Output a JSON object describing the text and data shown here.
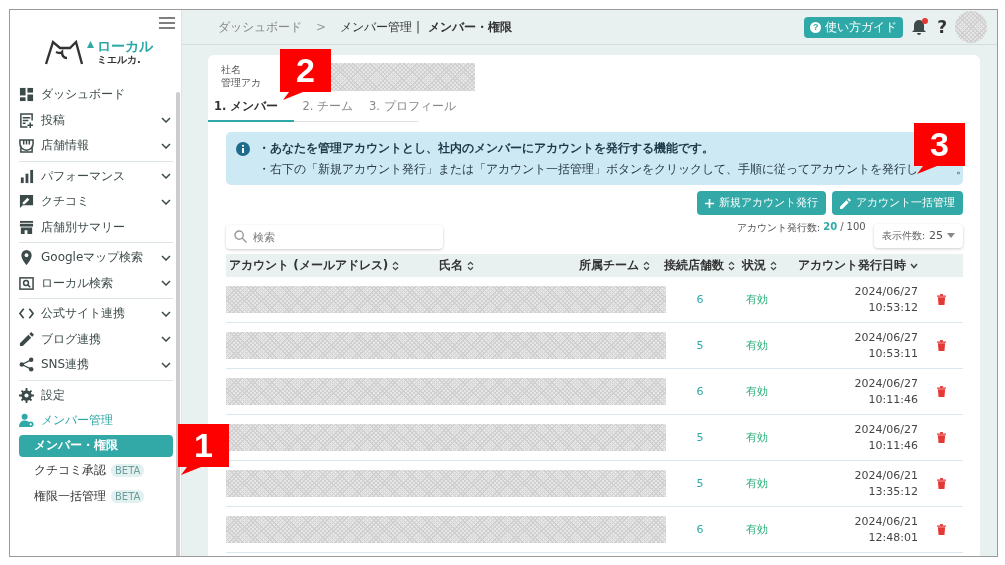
{
  "sidebar": {
    "logo": {
      "main": "ローカル",
      "sub": "ミエルカ."
    },
    "groups": [
      {
        "items": [
          {
            "label": "ダッシュボード",
            "kind": "dashboard",
            "expandable": false
          },
          {
            "label": "投稿",
            "kind": "post",
            "expandable": true
          },
          {
            "label": "店舗情報",
            "kind": "store",
            "expandable": true
          }
        ]
      },
      {
        "items": [
          {
            "label": "パフォーマンス",
            "kind": "bars",
            "expandable": true
          },
          {
            "label": "クチコミ",
            "kind": "review",
            "expandable": true
          },
          {
            "label": "店舗別サマリー",
            "kind": "shop",
            "expandable": false
          }
        ]
      },
      {
        "items": [
          {
            "label": "Googleマップ検索",
            "kind": "pin",
            "expandable": true
          },
          {
            "label": "ローカル検索",
            "kind": "search",
            "expandable": true
          }
        ]
      },
      {
        "items": [
          {
            "label": "公式サイト連携",
            "kind": "code",
            "expandable": true
          },
          {
            "label": "ブログ連携",
            "kind": "pencil",
            "expandable": true
          },
          {
            "label": "SNS連携",
            "kind": "share",
            "expandable": true
          }
        ]
      },
      {
        "items": [
          {
            "label": "設定",
            "kind": "gear",
            "expandable": false
          },
          {
            "label": "メンバー管理",
            "kind": "members",
            "expandable": false,
            "expanded": true,
            "children": [
              {
                "label": "メンバー・権限",
                "selected": true
              },
              {
                "label": "クチコミ承認",
                "selected": false,
                "badge": "BETA"
              },
              {
                "label": "権限一括管理",
                "selected": false,
                "badge": "BETA"
              }
            ]
          }
        ]
      }
    ]
  },
  "header": {
    "breadcrumb": "ダッシュボード",
    "separator": ">",
    "section": "メンバー管理",
    "divider": "|",
    "title": "メンバー・権限",
    "guide_icon": "?",
    "guide_button": "使い方ガイド",
    "notification": true,
    "help": "?"
  },
  "card": {
    "company_label": "社名",
    "admin_label": "管理アカ",
    "tabs": [
      {
        "label": "1. メンバー",
        "selected": true
      },
      {
        "label": "2. チーム",
        "selected": false
      },
      {
        "label": "3. プロフィール",
        "selected": false
      }
    ],
    "info": {
      "line_1": "・あなたを管理アカウントとし、社内のメンバーにアカウントを発行する機能です。",
      "line_2": "・右下の「新規アカウント発行」または「アカウント一括管理」ボタンをクリックして、手順に従ってアカウントを発行し",
      "line_2_tail": "。"
    },
    "buttons": [
      {
        "label": "新規アカウント発行",
        "kind": "plus"
      },
      {
        "label": "アカウント一括管理",
        "kind": "pencil"
      }
    ],
    "search": {
      "placeholder": "検索"
    },
    "issued": {
      "label": "アカウント発行数:",
      "count": "20",
      "separator": "/",
      "total": "100"
    },
    "page_size": {
      "label": "表示件数:",
      "value": "25"
    },
    "table": {
      "columns": [
        {
          "label": "アカウント (メールアドレス)",
          "kind": "sortable"
        },
        {
          "label": "氏名",
          "kind": "sortable"
        },
        {
          "label": "所属チーム",
          "kind": "sortable"
        },
        {
          "label": "接続店舗数",
          "kind": "sortable"
        },
        {
          "label": "状況",
          "kind": "sortable"
        },
        {
          "label": "アカウント発行日時",
          "kind": "sorted"
        }
      ],
      "rows": [
        {
          "stores": "6",
          "status": "有効",
          "date": "2024/06/27",
          "time": "10:53:12"
        },
        {
          "stores": "5",
          "status": "有効",
          "date": "2024/06/27",
          "time": "10:53:11"
        },
        {
          "stores": "6",
          "status": "有効",
          "date": "2024/06/27",
          "time": "10:11:46"
        },
        {
          "stores": "5",
          "status": "有効",
          "date": "2024/06/27",
          "time": "10:11:46"
        },
        {
          "stores": "5",
          "status": "有効",
          "date": "2024/06/21",
          "time": "13:35:12"
        },
        {
          "stores": "6",
          "status": "有効",
          "date": "2024/06/21",
          "time": "12:48:01"
        }
      ]
    }
  },
  "callouts": [
    {
      "number": "1"
    },
    {
      "number": "2"
    },
    {
      "number": "3"
    }
  ]
}
